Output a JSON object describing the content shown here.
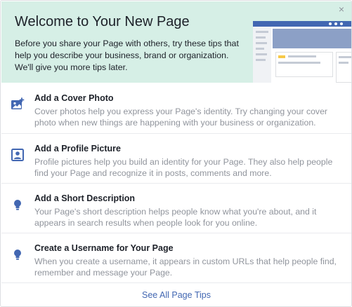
{
  "header": {
    "title": "Welcome to Your New Page",
    "subtitle": "Before you share your Page with others, try these tips that help you describe your business, brand or organization. We'll give you more tips later.",
    "close_glyph": "×"
  },
  "tips": [
    {
      "icon": "photo-add-icon",
      "title": "Add a Cover Photo",
      "description": "Cover photos help you express your Page's identity. Try changing your cover photo when new things are happening with your business or organization."
    },
    {
      "icon": "profile-picture-icon",
      "title": "Add a Profile Picture",
      "description": "Profile pictures help you build an identity for your Page. They also help people find your Page and recognize it in posts, comments and more."
    },
    {
      "icon": "lightbulb-icon",
      "title": "Add a Short Description",
      "description": "Your Page's short description helps people know what you're about, and it appears in search results when people look for you online."
    },
    {
      "icon": "lightbulb-icon",
      "title": "Create a Username for Your Page",
      "description": "When you create a username, it appears in custom URLs that help people find, remember and message your Page."
    }
  ],
  "footer": {
    "link_label": "See All Page Tips"
  },
  "colors": {
    "header_bg": "#d6efe6",
    "icon_blue": "#4267b2",
    "link_blue": "#4267b2",
    "muted_text": "#90949c"
  }
}
